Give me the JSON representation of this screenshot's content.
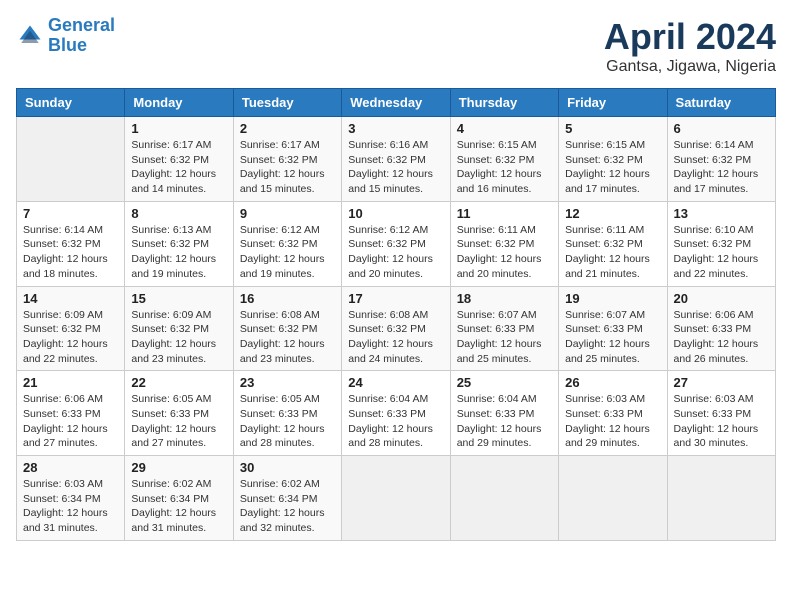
{
  "header": {
    "logo_line1": "General",
    "logo_line2": "Blue",
    "month_title": "April 2024",
    "location": "Gantsa, Jigawa, Nigeria"
  },
  "weekdays": [
    "Sunday",
    "Monday",
    "Tuesday",
    "Wednesday",
    "Thursday",
    "Friday",
    "Saturday"
  ],
  "weeks": [
    [
      {
        "day": "",
        "sunrise": "",
        "sunset": "",
        "daylight": ""
      },
      {
        "day": "1",
        "sunrise": "Sunrise: 6:17 AM",
        "sunset": "Sunset: 6:32 PM",
        "daylight": "Daylight: 12 hours and 14 minutes."
      },
      {
        "day": "2",
        "sunrise": "Sunrise: 6:17 AM",
        "sunset": "Sunset: 6:32 PM",
        "daylight": "Daylight: 12 hours and 15 minutes."
      },
      {
        "day": "3",
        "sunrise": "Sunrise: 6:16 AM",
        "sunset": "Sunset: 6:32 PM",
        "daylight": "Daylight: 12 hours and 15 minutes."
      },
      {
        "day": "4",
        "sunrise": "Sunrise: 6:15 AM",
        "sunset": "Sunset: 6:32 PM",
        "daylight": "Daylight: 12 hours and 16 minutes."
      },
      {
        "day": "5",
        "sunrise": "Sunrise: 6:15 AM",
        "sunset": "Sunset: 6:32 PM",
        "daylight": "Daylight: 12 hours and 17 minutes."
      },
      {
        "day": "6",
        "sunrise": "Sunrise: 6:14 AM",
        "sunset": "Sunset: 6:32 PM",
        "daylight": "Daylight: 12 hours and 17 minutes."
      }
    ],
    [
      {
        "day": "7",
        "sunrise": "Sunrise: 6:14 AM",
        "sunset": "Sunset: 6:32 PM",
        "daylight": "Daylight: 12 hours and 18 minutes."
      },
      {
        "day": "8",
        "sunrise": "Sunrise: 6:13 AM",
        "sunset": "Sunset: 6:32 PM",
        "daylight": "Daylight: 12 hours and 19 minutes."
      },
      {
        "day": "9",
        "sunrise": "Sunrise: 6:12 AM",
        "sunset": "Sunset: 6:32 PM",
        "daylight": "Daylight: 12 hours and 19 minutes."
      },
      {
        "day": "10",
        "sunrise": "Sunrise: 6:12 AM",
        "sunset": "Sunset: 6:32 PM",
        "daylight": "Daylight: 12 hours and 20 minutes."
      },
      {
        "day": "11",
        "sunrise": "Sunrise: 6:11 AM",
        "sunset": "Sunset: 6:32 PM",
        "daylight": "Daylight: 12 hours and 20 minutes."
      },
      {
        "day": "12",
        "sunrise": "Sunrise: 6:11 AM",
        "sunset": "Sunset: 6:32 PM",
        "daylight": "Daylight: 12 hours and 21 minutes."
      },
      {
        "day": "13",
        "sunrise": "Sunrise: 6:10 AM",
        "sunset": "Sunset: 6:32 PM",
        "daylight": "Daylight: 12 hours and 22 minutes."
      }
    ],
    [
      {
        "day": "14",
        "sunrise": "Sunrise: 6:09 AM",
        "sunset": "Sunset: 6:32 PM",
        "daylight": "Daylight: 12 hours and 22 minutes."
      },
      {
        "day": "15",
        "sunrise": "Sunrise: 6:09 AM",
        "sunset": "Sunset: 6:32 PM",
        "daylight": "Daylight: 12 hours and 23 minutes."
      },
      {
        "day": "16",
        "sunrise": "Sunrise: 6:08 AM",
        "sunset": "Sunset: 6:32 PM",
        "daylight": "Daylight: 12 hours and 23 minutes."
      },
      {
        "day": "17",
        "sunrise": "Sunrise: 6:08 AM",
        "sunset": "Sunset: 6:32 PM",
        "daylight": "Daylight: 12 hours and 24 minutes."
      },
      {
        "day": "18",
        "sunrise": "Sunrise: 6:07 AM",
        "sunset": "Sunset: 6:33 PM",
        "daylight": "Daylight: 12 hours and 25 minutes."
      },
      {
        "day": "19",
        "sunrise": "Sunrise: 6:07 AM",
        "sunset": "Sunset: 6:33 PM",
        "daylight": "Daylight: 12 hours and 25 minutes."
      },
      {
        "day": "20",
        "sunrise": "Sunrise: 6:06 AM",
        "sunset": "Sunset: 6:33 PM",
        "daylight": "Daylight: 12 hours and 26 minutes."
      }
    ],
    [
      {
        "day": "21",
        "sunrise": "Sunrise: 6:06 AM",
        "sunset": "Sunset: 6:33 PM",
        "daylight": "Daylight: 12 hours and 27 minutes."
      },
      {
        "day": "22",
        "sunrise": "Sunrise: 6:05 AM",
        "sunset": "Sunset: 6:33 PM",
        "daylight": "Daylight: 12 hours and 27 minutes."
      },
      {
        "day": "23",
        "sunrise": "Sunrise: 6:05 AM",
        "sunset": "Sunset: 6:33 PM",
        "daylight": "Daylight: 12 hours and 28 minutes."
      },
      {
        "day": "24",
        "sunrise": "Sunrise: 6:04 AM",
        "sunset": "Sunset: 6:33 PM",
        "daylight": "Daylight: 12 hours and 28 minutes."
      },
      {
        "day": "25",
        "sunrise": "Sunrise: 6:04 AM",
        "sunset": "Sunset: 6:33 PM",
        "daylight": "Daylight: 12 hours and 29 minutes."
      },
      {
        "day": "26",
        "sunrise": "Sunrise: 6:03 AM",
        "sunset": "Sunset: 6:33 PM",
        "daylight": "Daylight: 12 hours and 29 minutes."
      },
      {
        "day": "27",
        "sunrise": "Sunrise: 6:03 AM",
        "sunset": "Sunset: 6:33 PM",
        "daylight": "Daylight: 12 hours and 30 minutes."
      }
    ],
    [
      {
        "day": "28",
        "sunrise": "Sunrise: 6:03 AM",
        "sunset": "Sunset: 6:34 PM",
        "daylight": "Daylight: 12 hours and 31 minutes."
      },
      {
        "day": "29",
        "sunrise": "Sunrise: 6:02 AM",
        "sunset": "Sunset: 6:34 PM",
        "daylight": "Daylight: 12 hours and 31 minutes."
      },
      {
        "day": "30",
        "sunrise": "Sunrise: 6:02 AM",
        "sunset": "Sunset: 6:34 PM",
        "daylight": "Daylight: 12 hours and 32 minutes."
      },
      {
        "day": "",
        "sunrise": "",
        "sunset": "",
        "daylight": ""
      },
      {
        "day": "",
        "sunrise": "",
        "sunset": "",
        "daylight": ""
      },
      {
        "day": "",
        "sunrise": "",
        "sunset": "",
        "daylight": ""
      },
      {
        "day": "",
        "sunrise": "",
        "sunset": "",
        "daylight": ""
      }
    ]
  ]
}
